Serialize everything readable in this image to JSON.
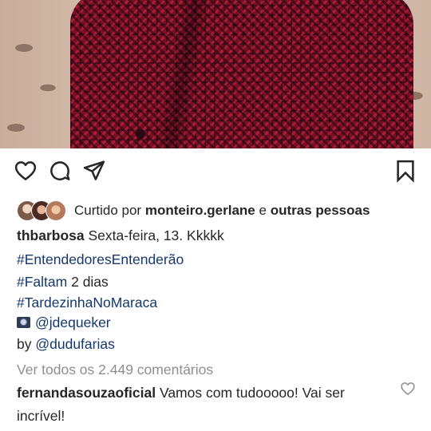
{
  "post": {
    "likes": {
      "prefix": "Curtido por",
      "user": "monteiro.gerlane",
      "connector": "e",
      "others": "outras pessoas"
    },
    "caption": {
      "author": "thbarbosa",
      "text": "Sexta-feira, 13. Kkkkk",
      "hashtag1": "#EntendedoresEntenderão",
      "hashtag2_tag": "#Faltam",
      "hashtag2_text": "2 dias",
      "hashtag3": "#TardezinhaNoMaraca",
      "mention1": "@jdequeker",
      "by_prefix": "by",
      "mention2": "@dudufarias"
    },
    "view_comments": "Ver todos os 2.449 comentários",
    "comment": {
      "author": "fernandasouzaoficial",
      "text_line1": "Vamos com tudooooo! Vai ser",
      "text_line2": "incrível!"
    }
  },
  "icons": [
    "heart-icon",
    "comment-icon",
    "share-icon",
    "bookmark-icon",
    "camera-emoji-icon",
    "small-heart-icon"
  ]
}
